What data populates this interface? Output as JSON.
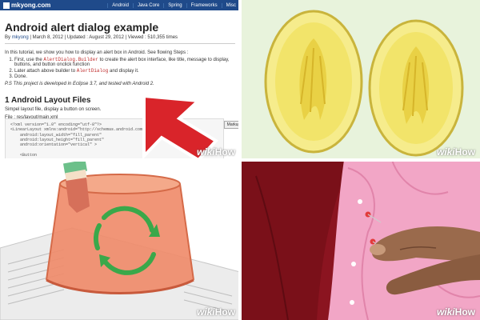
{
  "watermark": {
    "w1": "wiki",
    "w2": "How"
  },
  "panel1": {
    "site": {
      "logo": "mkyong.com",
      "nav": [
        "Android",
        "Java Core",
        "Spring",
        "Frameworks",
        "Misc"
      ]
    },
    "article": {
      "title": "Android alert dialog example",
      "meta_by": "By",
      "author": "mkyong",
      "meta_rest": "| March 8, 2012 | Updated : August 29, 2012 | Viewed : 510,355 times",
      "intro": "In this tutorial, we show you how to display an alert box in Android. See flowing Steps :",
      "steps": [
        {
          "pre": "First, use the ",
          "code": "AlertDialog.Builder",
          "post": " to create the alert box interface, like title, message to display, buttons, and button onclick function"
        },
        {
          "pre": "Later attach above builder to ",
          "code": "AlertDialog",
          "post": " and display it."
        },
        {
          "pre": "Done.",
          "code": "",
          "post": ""
        }
      ],
      "note": "P.S This project is developed in Eclipse 3.7, and tested with Android 2.",
      "section_title": "1 Android Layout Files",
      "section_sub": "Simpel layout file, display a button on screen.",
      "file_label": "File : res/layout/main.xml",
      "markup_button": "Markup",
      "code_lines": [
        "<?xml version=\"1.0\" encoding=\"utf-8\"?>",
        "<LinearLayout xmlns:android=\"http://schemas.android.com/apk/res/android\"",
        "    android:layout_width=\"fill_parent\"",
        "    android:layout_height=\"fill_parent\"",
        "    android:orientation=\"vertical\" >",
        "",
        "    <Button"
      ]
    },
    "arrow_color": "#d9242a"
  },
  "panel2": {
    "bg": "#e8f3dc",
    "fruit_color": "#f2e46a"
  },
  "panel3": {
    "lamp_color": "#f08a68",
    "arrow_color": "#3aa84a"
  },
  "panel4": {
    "bg": "#8b1420",
    "shirt_color": "#f2a6c6",
    "pin_color": "#e23b3b"
  }
}
